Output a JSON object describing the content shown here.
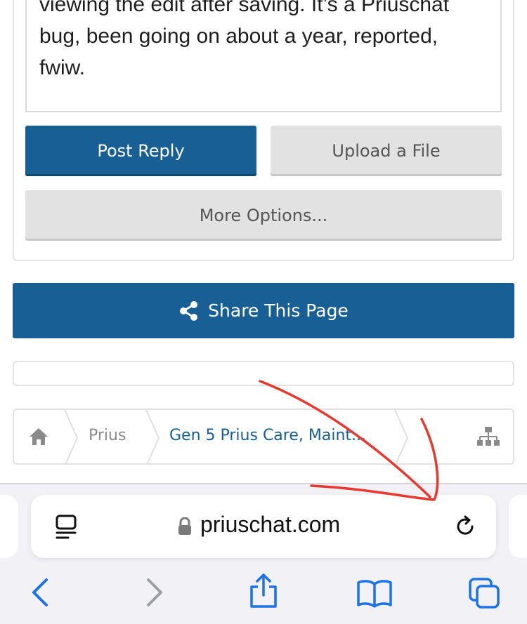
{
  "editor": {
    "lines": [
      "viewing the edit after saving. It’s a Priuschat",
      "bug, been going on about a year, reported,",
      "fwiw."
    ]
  },
  "actions": {
    "post_reply_label": "Post Reply",
    "upload_label": "Upload a File",
    "more_options_label": "More Options..."
  },
  "share": {
    "label": "Share This Page"
  },
  "breadcrumb": {
    "items": [
      "Prius",
      "Gen 5 Prius Care, Maint..."
    ]
  },
  "browser": {
    "url": "priuschat.com",
    "accent_color": "#1a73e8"
  },
  "annotation": {
    "color": "#e8372c"
  }
}
